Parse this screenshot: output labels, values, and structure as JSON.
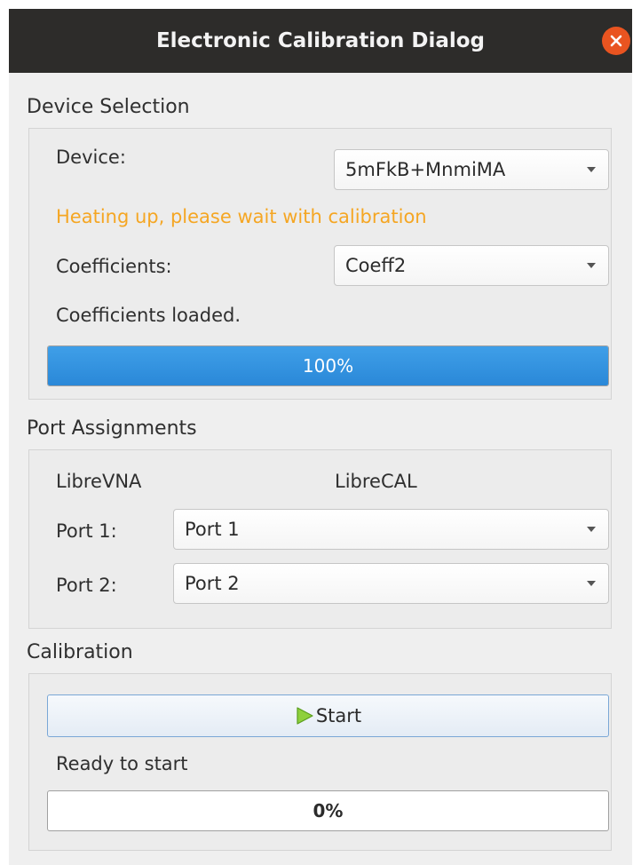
{
  "window": {
    "title": "Electronic Calibration Dialog"
  },
  "colors": {
    "titlebar": "#2d2c2a",
    "close": "#e95420",
    "warning": "#f5a623",
    "progress_fill": "#2a88d8",
    "play_icon": "#8ed03c"
  },
  "device_selection": {
    "heading": "Device Selection",
    "device_label": "Device:",
    "device_value": "5mFkB+MnmiMA",
    "warning": "Heating up, please wait with calibration",
    "coefficients_label": "Coefficients:",
    "coefficients_value": "Coeff2",
    "status": "Coefficients loaded.",
    "progress_percent": 100,
    "progress_text": "100%"
  },
  "port_assignments": {
    "heading": "Port Assignments",
    "col_vna": "LibreVNA",
    "col_cal": "LibreCAL",
    "ports": [
      {
        "label": "Port 1:",
        "value": "Port 1"
      },
      {
        "label": "Port 2:",
        "value": "Port 2"
      }
    ]
  },
  "calibration": {
    "heading": "Calibration",
    "start_label": "Start",
    "start_icon": "play-icon",
    "status": "Ready to start",
    "progress_percent": 0,
    "progress_text": "0%"
  }
}
